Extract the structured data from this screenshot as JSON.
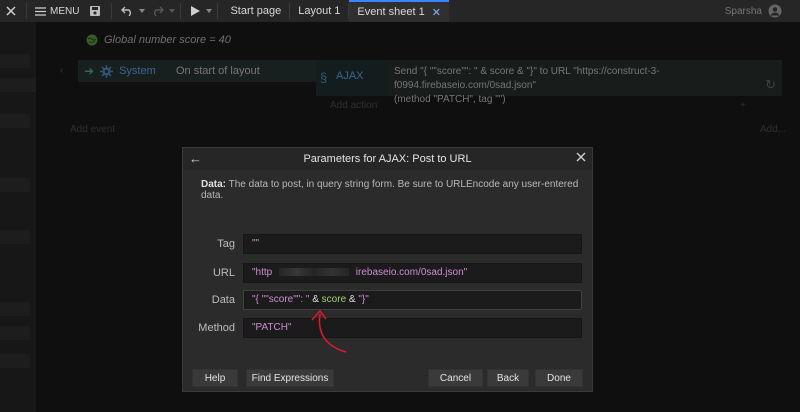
{
  "topbar": {
    "menu_label": "MENU",
    "tabs": [
      {
        "label": "Start page"
      },
      {
        "label": "Layout 1"
      },
      {
        "label": "Event sheet 1"
      }
    ],
    "user_name": "Sparsha"
  },
  "sheet": {
    "global_var": "Global number score = 40",
    "condition_object": "System",
    "condition_text": "On start of layout",
    "action_object": "AJAX",
    "action_line1": "Send \"{ \"\"score\"\": \" & score & \"}\" to URL \"https://construct-3-f0994.firebaseio.com/0sad.json\"",
    "action_line2": "(method \"PATCH\", tag \"\")",
    "add_action": "Add action",
    "add_event": "Add event",
    "add_more": "Add..."
  },
  "dialog": {
    "title": "Parameters for AJAX: Post to URL",
    "desc_label": "Data:",
    "desc_text": "The data to post, in query string form. Be sure to URLEncode any user-entered data.",
    "params": {
      "tag": {
        "label": "Tag",
        "value": "\"\""
      },
      "url": {
        "label": "URL",
        "value_prefix": "\"http",
        "value_suffix": "irebaseio.com/0sad.json\""
      },
      "data": {
        "label": "Data",
        "part1": "\"{ \"\"score\"\": \"",
        "part2": "&",
        "part3": "score",
        "part4": "&",
        "part5": "\"}\""
      },
      "method": {
        "label": "Method",
        "value": "\"PATCH\""
      }
    },
    "buttons": {
      "help": "Help",
      "find": "Find Expressions",
      "cancel": "Cancel",
      "back": "Back",
      "done": "Done"
    }
  },
  "colors": {
    "string": "#d08cd6",
    "variable": "#9fd16c",
    "annotation": "#d81b2a",
    "accent": "#3a86ff"
  }
}
